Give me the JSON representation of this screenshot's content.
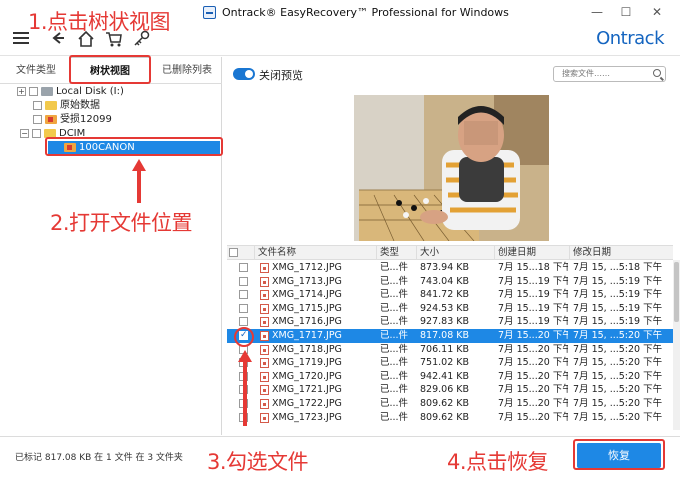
{
  "window": {
    "title": "Ontrack® EasyRecovery™ Professional for Windows",
    "minimize": "—",
    "maximize": "☐",
    "close": "✕"
  },
  "toolbar": {
    "brand": "Ontrack"
  },
  "left_tabs": [
    {
      "label": "文件类型"
    },
    {
      "label": "树状视图"
    },
    {
      "label": "已删除列表"
    }
  ],
  "tree": {
    "disk": "Local Disk (I:)",
    "items": [
      {
        "label": "原始数据"
      },
      {
        "label": "受损12099"
      },
      {
        "label": "DCIM"
      },
      {
        "label": "100CANON"
      }
    ]
  },
  "preview": {
    "toggle_label": "关闭预览",
    "search_placeholder": "搜索文件……"
  },
  "table": {
    "headers": [
      "文件名称",
      "类型",
      "大小",
      "创建日期",
      "修改日期"
    ],
    "rows": [
      {
        "name": "XMG_1712.JPG",
        "type": "已...件",
        "size": "873.94 KB",
        "created": "7月 15...18 下午",
        "modified": "7月 15, ...5:18 下午"
      },
      {
        "name": "XMG_1713.JPG",
        "type": "已...件",
        "size": "743.04 KB",
        "created": "7月 15...19 下午",
        "modified": "7月 15, ...5:19 下午"
      },
      {
        "name": "XMG_1714.JPG",
        "type": "已...件",
        "size": "841.72 KB",
        "created": "7月 15...19 下午",
        "modified": "7月 15, ...5:19 下午"
      },
      {
        "name": "XMG_1715.JPG",
        "type": "已...件",
        "size": "924.53 KB",
        "created": "7月 15...19 下午",
        "modified": "7月 15, ...5:19 下午"
      },
      {
        "name": "XMG_1716.JPG",
        "type": "已...件",
        "size": "927.83 KB",
        "created": "7月 15...19 下午",
        "modified": "7月 15, ...5:19 下午"
      },
      {
        "name": "XMG_1717.JPG",
        "type": "已...件",
        "size": "817.08 KB",
        "created": "7月 15...20 下午",
        "modified": "7月 15, ...5:20 下午",
        "checked": true,
        "selected": true
      },
      {
        "name": "XMG_1718.JPG",
        "type": "已...件",
        "size": "706.11 KB",
        "created": "7月 15...20 下午",
        "modified": "7月 15, ...5:20 下午"
      },
      {
        "name": "XMG_1719.JPG",
        "type": "已...件",
        "size": "751.02 KB",
        "created": "7月 15...20 下午",
        "modified": "7月 15, ...5:20 下午"
      },
      {
        "name": "XMG_1720.JPG",
        "type": "已...件",
        "size": "942.41 KB",
        "created": "7月 15...20 下午",
        "modified": "7月 15, ...5:20 下午"
      },
      {
        "name": "XMG_1721.JPG",
        "type": "已...件",
        "size": "829.06 KB",
        "created": "7月 15...20 下午",
        "modified": "7月 15, ...5:20 下午"
      },
      {
        "name": "XMG_1722.JPG",
        "type": "已...件",
        "size": "809.62 KB",
        "created": "7月 15...20 下午",
        "modified": "7月 15, ...5:20 下午"
      },
      {
        "name": "XMG_1723.JPG",
        "type": "已...件",
        "size": "809.62 KB",
        "created": "7月 15...20 下午",
        "modified": "7月 15, ...5:20 下午"
      }
    ]
  },
  "status": {
    "text": "已标记 817.08 KB 在 1 文件 在 3 文件夹",
    "recover_label": "恢复"
  },
  "annotations": {
    "step1": "1.点击树状视图",
    "step2": "2.打开文件位置",
    "step3": "3.勾选文件",
    "step4": "4.点击恢复",
    "color": "#e53935"
  }
}
